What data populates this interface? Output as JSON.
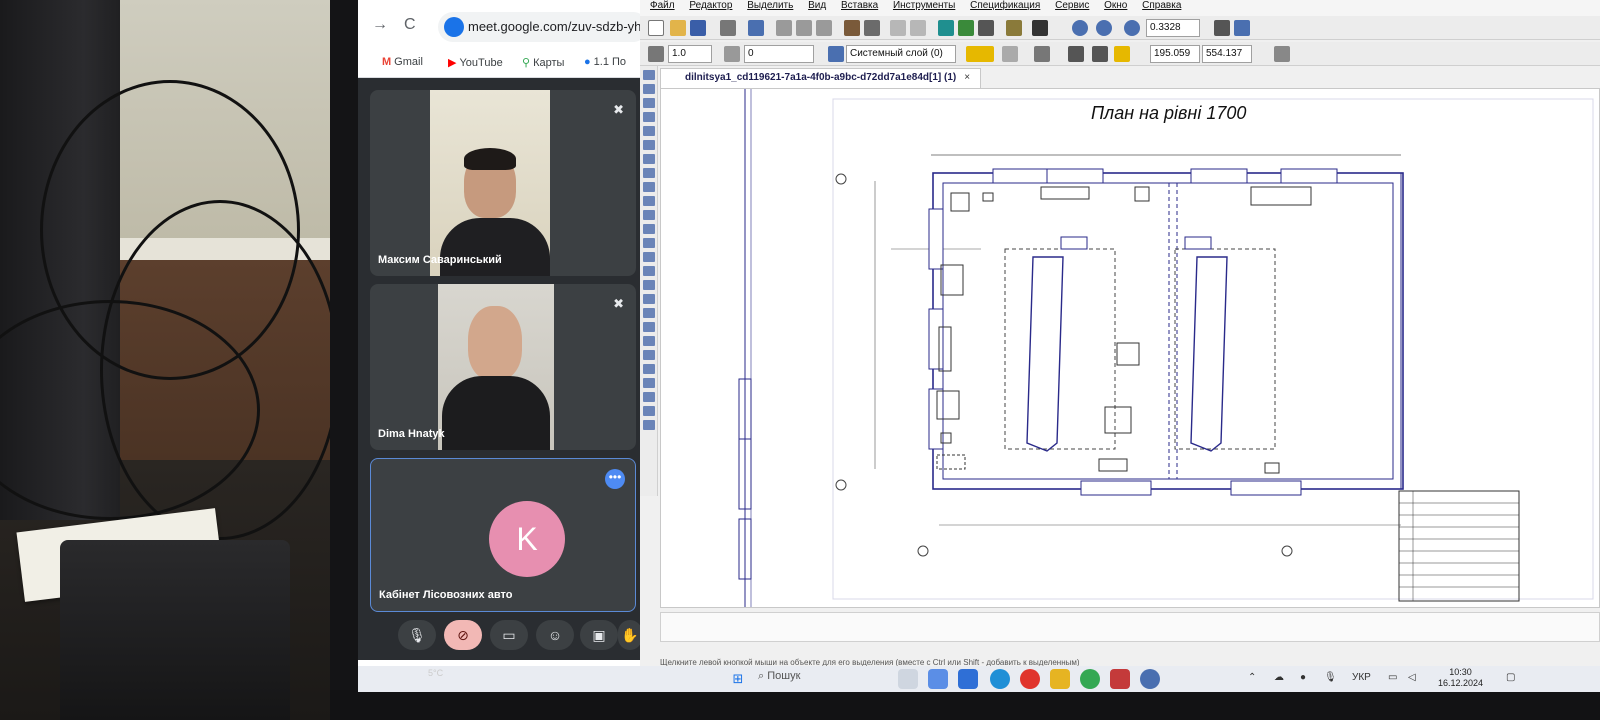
{
  "browser": {
    "url": "meet.google.com/zuv-sdzb-yh",
    "bookmarks": [
      "Gmail",
      "YouTube",
      "Карты",
      "1.1 По"
    ]
  },
  "meet": {
    "participants": [
      {
        "name": "Максим Саваринський"
      },
      {
        "name": "Dima Hnatyk"
      },
      {
        "name": "Кабінет Лісовозних авто",
        "initial": "K"
      }
    ]
  },
  "cad": {
    "menu": [
      "Файл",
      "Редактор",
      "Выделить",
      "Вид",
      "Вставка",
      "Инструменты",
      "Спецификация",
      "Сервис",
      "Окно",
      "Справка"
    ],
    "toolbar": {
      "zoom": "0.3328",
      "line_width": "1.0",
      "angle": "0",
      "layer": "Системный слой (0)",
      "coord_x": "195.059",
      "coord_y": "554.137"
    },
    "document_tab": "dilnitsya1_cd119621-7a1a-4f0b-a9bc-d72dd7a1e84d[1] (1)",
    "drawing": {
      "title": "План на рівні 1700"
    },
    "status": "Щелкните левой кнопкой мыши на объекте для его выделения (вместе с Ctrl или Shift - добавить к выделенным)"
  },
  "taskbar": {
    "search": "Пошук",
    "language": "УКР",
    "time": "10:30",
    "date": "16.12.2024",
    "notification": "5°C"
  }
}
